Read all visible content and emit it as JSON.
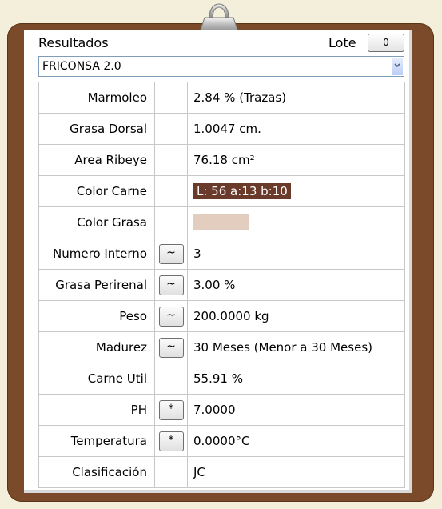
{
  "header": {
    "title": "Resultados",
    "lote_label": "Lote",
    "lote_value": "0"
  },
  "selector": {
    "selected": "FRICONSA 2.0"
  },
  "colors": {
    "board": "#7a4a2a",
    "color_carne_bg": "#6a3b2a",
    "color_grasa_swatch": "#e2cdbf"
  },
  "rows": [
    {
      "label": "Marmoleo",
      "button": "",
      "value": "2.84 % (Trazas)"
    },
    {
      "label": "Grasa Dorsal",
      "button": "",
      "value": "1.0047 cm."
    },
    {
      "label": "Area Ribeye",
      "button": "",
      "value": "76.18 cm²"
    },
    {
      "label": "Color Carne",
      "button": "",
      "value": "L: 56 a:13 b:10"
    },
    {
      "label": "Color Grasa",
      "button": "",
      "value": ""
    },
    {
      "label": "Numero Interno",
      "button": "~",
      "value": "3"
    },
    {
      "label": "Grasa Perirenal",
      "button": "~",
      "value": "3.00 %"
    },
    {
      "label": "Peso",
      "button": "~",
      "value": "200.0000 kg"
    },
    {
      "label": "Madurez",
      "button": "~",
      "value": "30 Meses (Menor a 30 Meses)"
    },
    {
      "label": "Carne Util",
      "button": "",
      "value": "55.91 %"
    },
    {
      "label": "PH",
      "button": "*",
      "value": "7.0000"
    },
    {
      "label": "Temperatura",
      "button": "*",
      "value": "0.0000°C"
    },
    {
      "label": "Clasificación",
      "button": "",
      "value": "JC"
    }
  ]
}
